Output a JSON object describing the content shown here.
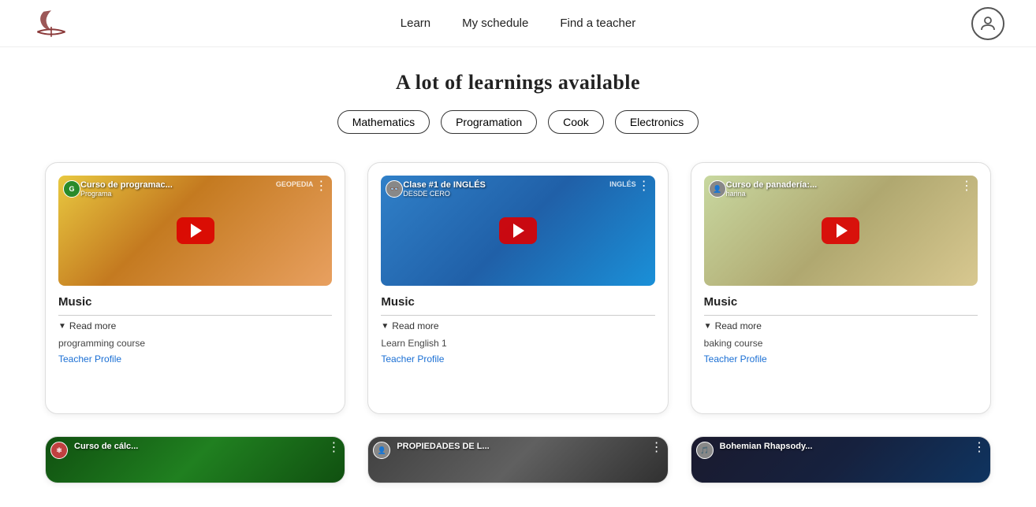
{
  "header": {
    "nav": {
      "learn": "Learn",
      "schedule": "My schedule",
      "find_teacher": "Find a teacher"
    }
  },
  "page": {
    "title": "A lot of learnings available"
  },
  "filters": [
    "Mathematics",
    "Programation",
    "Cook",
    "Electronics"
  ],
  "cards": [
    {
      "id": "card-1",
      "thumb_class": "thumb-1",
      "channel_label": "G",
      "channel_class": "green-icon",
      "thumb_title": "Curso de programac...",
      "thumb_subtitle": "Programa",
      "yt_label": "GEOPEDIA",
      "card_title": "Music",
      "read_more": "Read more",
      "description": "programming course",
      "teacher_profile": "Teacher Profile"
    },
    {
      "id": "card-2",
      "thumb_class": "thumb-2",
      "channel_label": "👓",
      "channel_class": "person-icon",
      "thumb_title": "Clase #1 de INGLÉS",
      "thumb_subtitle": "DESDE CERO",
      "yt_label": "INGLÉS",
      "card_title": "Music",
      "read_more": "Read more",
      "description": "Learn English 1",
      "teacher_profile": "Teacher Profile"
    },
    {
      "id": "card-3",
      "thumb_class": "thumb-3",
      "channel_label": "👤",
      "channel_class": "person-icon",
      "thumb_title": "Curso de panadería:...",
      "thumb_subtitle": "harina",
      "yt_label": "",
      "card_title": "Music",
      "read_more": "Read more",
      "description": "baking course",
      "teacher_profile": "Teacher Profile"
    }
  ],
  "partial_cards": [
    {
      "id": "partial-1",
      "thumb_class": "thumb-4",
      "channel_label": "⚛",
      "channel_class": "red-icon",
      "thumb_title": "Curso de cálc..."
    },
    {
      "id": "partial-2",
      "thumb_class": "thumb-5",
      "channel_label": "👤",
      "channel_class": "person-icon",
      "thumb_title": "PROPIEDADES DE L..."
    },
    {
      "id": "partial-3",
      "thumb_class": "thumb-6",
      "channel_label": "🎵",
      "channel_class": "person-icon",
      "thumb_title": "Bohemian Rhapsody..."
    }
  ]
}
